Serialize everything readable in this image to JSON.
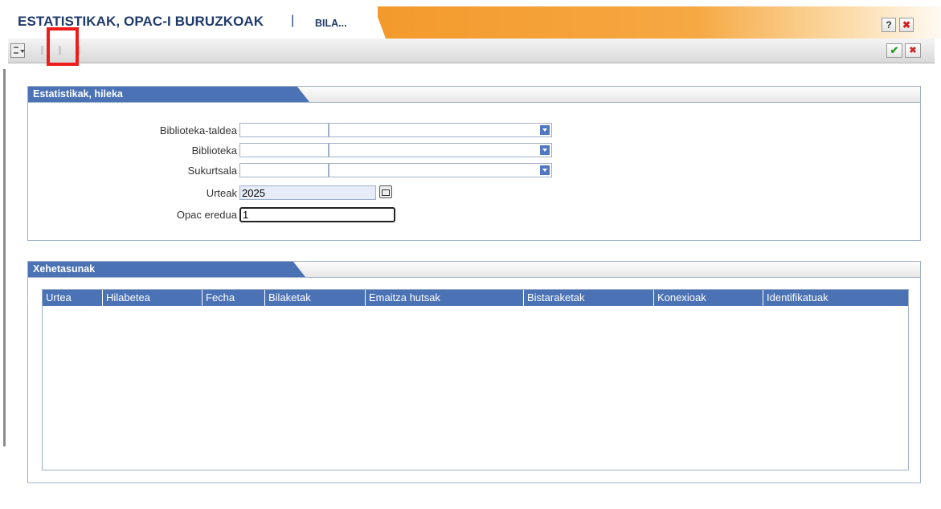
{
  "window": {
    "title": "ESTATISTIKAK, OPAC-I BURUZKOAK",
    "separator": "|",
    "tab": "BILA...",
    "help_label": "?",
    "close_label": "✖"
  },
  "toolbar": {
    "menu_icon": "menu-dropdown-icon",
    "ok_label": "✔",
    "cancel_label": "✖"
  },
  "panel_filters": {
    "title": "Estatistikak, hileka",
    "fields": {
      "biblioteka_taldea": {
        "label": "Biblioteka-taldea",
        "code": "",
        "value": ""
      },
      "biblioteka": {
        "label": "Biblioteka",
        "code": "",
        "value": ""
      },
      "sukurtsala": {
        "label": "Sukurtsala",
        "code": "",
        "value": ""
      },
      "urteak": {
        "label": "Urteak",
        "value": "2025"
      },
      "opac_eredua": {
        "label": "Opac eredua",
        "value": "1"
      }
    }
  },
  "panel_details": {
    "title": "Xehetasunak",
    "columns": [
      "Urtea",
      "Hilabetea",
      "Fecha",
      "Bilaketak",
      "Emaitza hutsak",
      "Bistaraketak",
      "Konexioak",
      "Identifikatuak"
    ],
    "rows": []
  },
  "colors": {
    "header_blue": "#4a72b5",
    "title_orange": "#f39a2c",
    "highlight_red": "#ee1b1b"
  }
}
